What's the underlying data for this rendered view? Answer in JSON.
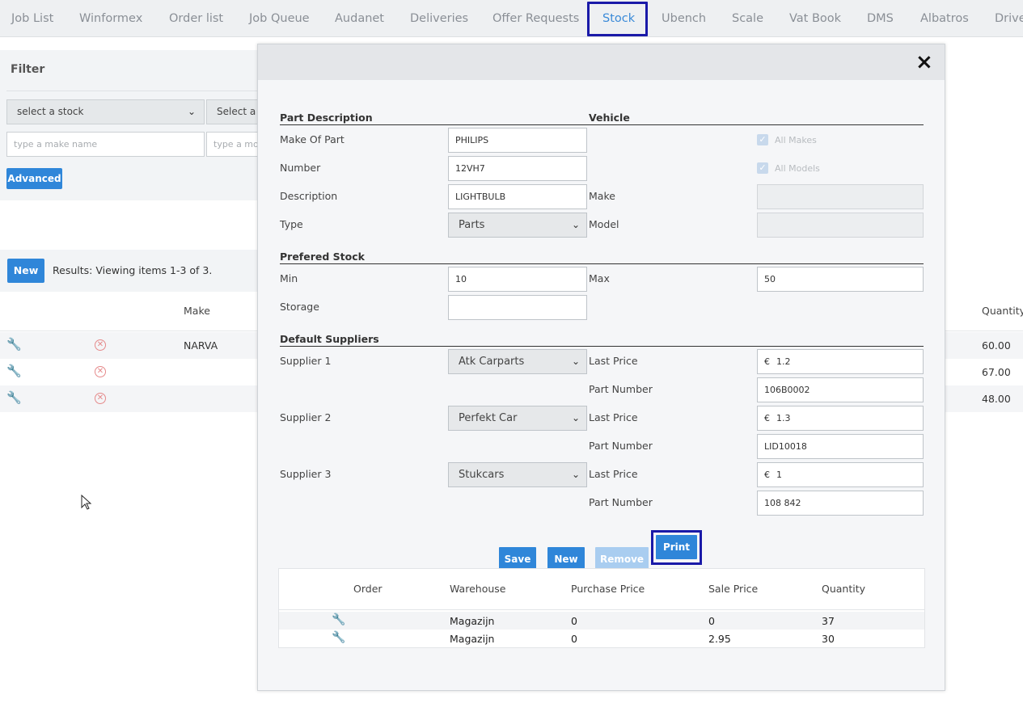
{
  "nav": {
    "tabs": [
      "Job List",
      "Winformex",
      "Order list",
      "Job Queue",
      "Audanet",
      "Deliveries",
      "Offer Requests",
      "Stock",
      "Ubench",
      "Scale",
      "Vat Book",
      "DMS",
      "Albatros",
      "Drive"
    ],
    "active_tab": "Stock"
  },
  "filter": {
    "title": "Filter",
    "stock_select": "select a stock",
    "second_select": "Select a s",
    "make_placeholder": "type a make name",
    "model_placeholder": "type a mod",
    "advanced_button": "Advanced"
  },
  "results": {
    "new_button": "New",
    "summary": "Results: Viewing items 1-3 of 3.",
    "columns": {
      "make": "Make",
      "quantity": "Quantity"
    },
    "rows": [
      {
        "make": "NARVA",
        "quantity": "60.00"
      },
      {
        "make": "",
        "quantity": "67.00"
      },
      {
        "make": "",
        "quantity": "48.00"
      }
    ]
  },
  "modal": {
    "close_icon": "×",
    "part_description": {
      "title": "Part Description",
      "make_of_part_label": "Make Of Part",
      "make_of_part": "PHILIPS",
      "number_label": "Number",
      "number": "12VH7",
      "description_label": "Description",
      "description": "LIGHTBULB",
      "type_label": "Type",
      "type": "Parts"
    },
    "vehicle": {
      "title": "Vehicle",
      "all_makes_label": "All Makes",
      "all_makes_checked": true,
      "all_models_label": "All Models",
      "all_models_checked": true,
      "make_label": "Make",
      "make": "",
      "model_label": "Model",
      "model": ""
    },
    "prefered_stock": {
      "title": "Prefered Stock",
      "min_label": "Min",
      "min": "10",
      "max_label": "Max",
      "max": "50",
      "storage_label": "Storage",
      "storage": ""
    },
    "default_suppliers": {
      "title": "Default Suppliers",
      "last_price_label": "Last Price",
      "part_number_label": "Part Number",
      "currency": "€",
      "suppliers": [
        {
          "label": "Supplier 1",
          "name": "Atk Carparts",
          "last_price": "1.2",
          "part_number": "106B0002"
        },
        {
          "label": "Supplier 2",
          "name": "Perfekt Car",
          "last_price": "1.3",
          "part_number": "LID10018"
        },
        {
          "label": "Supplier 3",
          "name": "Stukcars",
          "last_price": "1",
          "part_number": "108 842"
        }
      ]
    },
    "buttons": {
      "save": "Save",
      "new": "New",
      "remove": "Remove",
      "print": "Print"
    },
    "stock_table": {
      "columns": {
        "order": "Order",
        "warehouse": "Warehouse",
        "purchase_price": "Purchase Price",
        "sale_price": "Sale Price",
        "quantity": "Quantity"
      },
      "rows": [
        {
          "warehouse": "Magazijn",
          "purchase_price": "0",
          "sale_price": "0",
          "quantity": "37"
        },
        {
          "warehouse": "Magazijn",
          "purchase_price": "0",
          "sale_price": "2.95",
          "quantity": "30"
        }
      ]
    }
  },
  "colors": {
    "accent": "#2f86d9",
    "highlight": "#1a1aa8",
    "active_tab": "#3a8ad8"
  }
}
